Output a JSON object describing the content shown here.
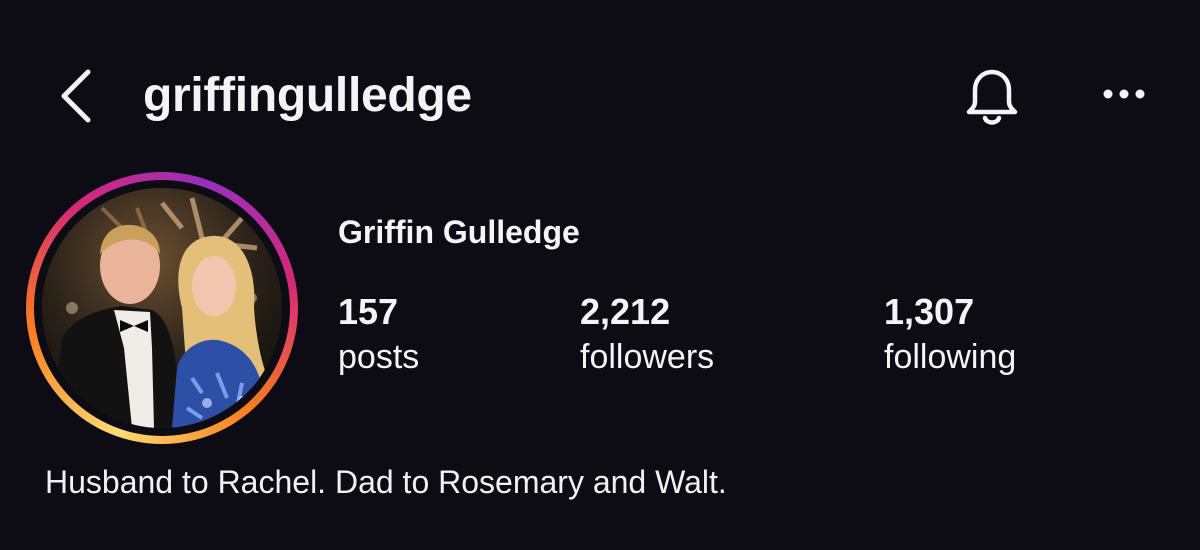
{
  "header": {
    "username": "griffingulledge",
    "back_icon": "chevron-left-icon",
    "bell_icon": "bell-icon",
    "more_icon": "more-horizontal-icon"
  },
  "profile": {
    "display_name": "Griffin Gulledge",
    "bio": "Husband to Rachel. Dad to Rosemary and Walt.",
    "story_ring_colors": [
      "#feda75",
      "#fa7e1e",
      "#d62976",
      "#962fbf"
    ]
  },
  "stats": [
    {
      "count": "157",
      "label": "posts"
    },
    {
      "count": "2,212",
      "label": "followers"
    },
    {
      "count": "1,307",
      "label": "following"
    }
  ]
}
